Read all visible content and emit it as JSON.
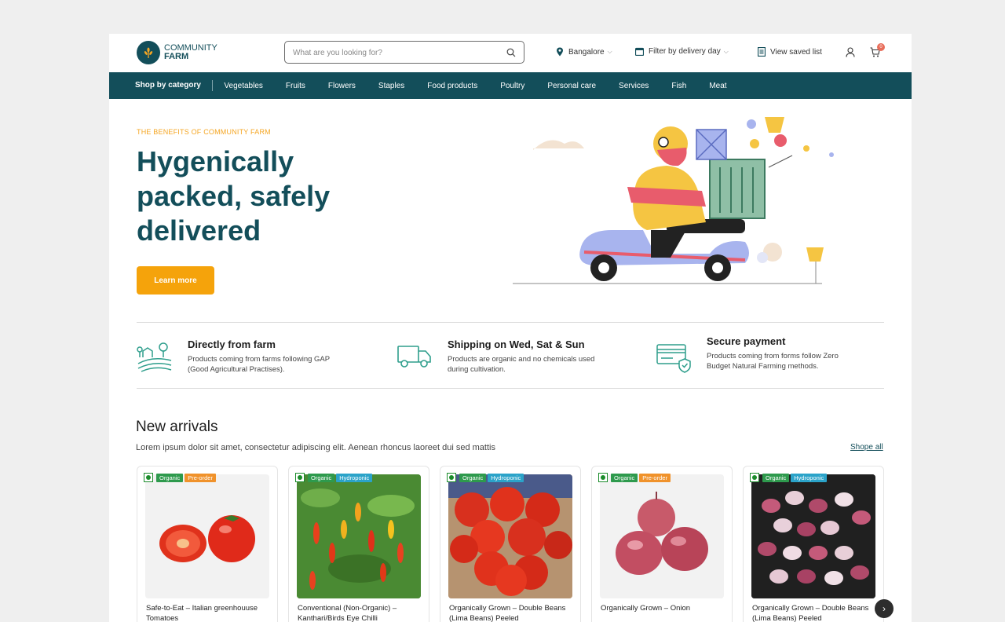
{
  "brand": {
    "line1": "COMMUNITY",
    "line2": "FARM"
  },
  "search": {
    "placeholder": "What are you looking for?"
  },
  "header": {
    "location": "Bangalore",
    "delivery_filter": "Filter by delivery day",
    "saved_list": "View saved list",
    "cart_count": "0"
  },
  "nav": {
    "shop_by_category": "Shop by category",
    "categories": [
      "Vegetables",
      "Fruits",
      "Flowers",
      "Staples",
      "Food products",
      "Poultry",
      "Personal care",
      "Services",
      "Fish",
      "Meat"
    ]
  },
  "hero": {
    "eyebrow": "THE BENEFITS OF COMMUNITY FARM",
    "title": "Hygenically packed, safely delivered",
    "cta": "Learn more"
  },
  "features": [
    {
      "title": "Directly from farm",
      "desc": "Products coming from farms following GAP (Good Agricultural Practises).",
      "icon": "farm-icon"
    },
    {
      "title": "Shipping on Wed, Sat & Sun",
      "desc": "Products are organic and no chemicals used during cultivation.",
      "icon": "truck-icon"
    },
    {
      "title": "Secure payment",
      "desc": "Products coming from forms follow Zero Budget Natural Farming methods.",
      "icon": "secure-card-icon"
    }
  ],
  "new_arrivals": {
    "title": "New arrivals",
    "subtitle": "Lorem ipsum dolor sit amet, consectetur adipiscing elit. Aenean rhoncus laoreet dui sed mattis",
    "shop_all": "Shope all",
    "products": [
      {
        "name": "Safe-to-Eat – Italian greenhouuse Tomatoes",
        "badges": [
          "Organic",
          "Pre-order"
        ]
      },
      {
        "name": "Conventional (Non-Organic) – Kanthari/Birds Eye Chilli",
        "badges": [
          "Organic",
          "Hydroponic"
        ]
      },
      {
        "name": "Organically Grown – Double Beans (Lima Beans) Peeled",
        "badges": [
          "Organic",
          "Hydroponic"
        ]
      },
      {
        "name": "Organically Grown – Onion",
        "badges": [
          "Organic",
          "Pre-order"
        ]
      },
      {
        "name": "Organically Grown – Double Beans (Lima Beans) Peeled",
        "badges": [
          "Organic",
          "Hydroponic"
        ]
      }
    ]
  },
  "colors": {
    "primary": "#134e5a",
    "accent": "#f5a30b",
    "organic": "#2e9a4d",
    "preorder": "#f0922b",
    "hydroponic": "#2ba3c9"
  }
}
